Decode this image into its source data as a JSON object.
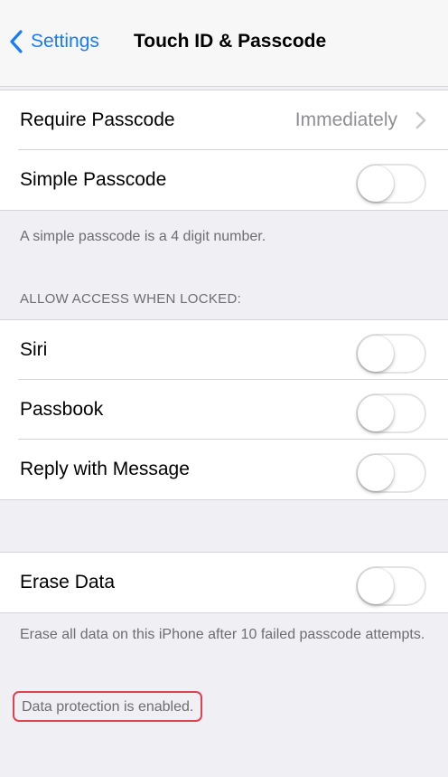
{
  "navbar": {
    "back_label": "Settings",
    "title": "Touch ID & Passcode"
  },
  "group1": {
    "require_passcode": {
      "label": "Require Passcode",
      "value": "Immediately"
    },
    "simple_passcode": {
      "label": "Simple Passcode",
      "on": false
    },
    "footer": "A simple passcode is a 4 digit number."
  },
  "allow_access": {
    "header": "ALLOW ACCESS WHEN LOCKED:",
    "items": [
      {
        "label": "Siri",
        "on": false
      },
      {
        "label": "Passbook",
        "on": false
      },
      {
        "label": "Reply with Message",
        "on": false
      }
    ]
  },
  "erase": {
    "label": "Erase Data",
    "on": false,
    "footer": "Erase all data on this iPhone after 10 failed passcode attempts.",
    "protection_note": "Data protection is enabled."
  },
  "colors": {
    "accent": "#1a7cf5",
    "highlight_border": "#e0424f",
    "background": "#efeff4"
  }
}
